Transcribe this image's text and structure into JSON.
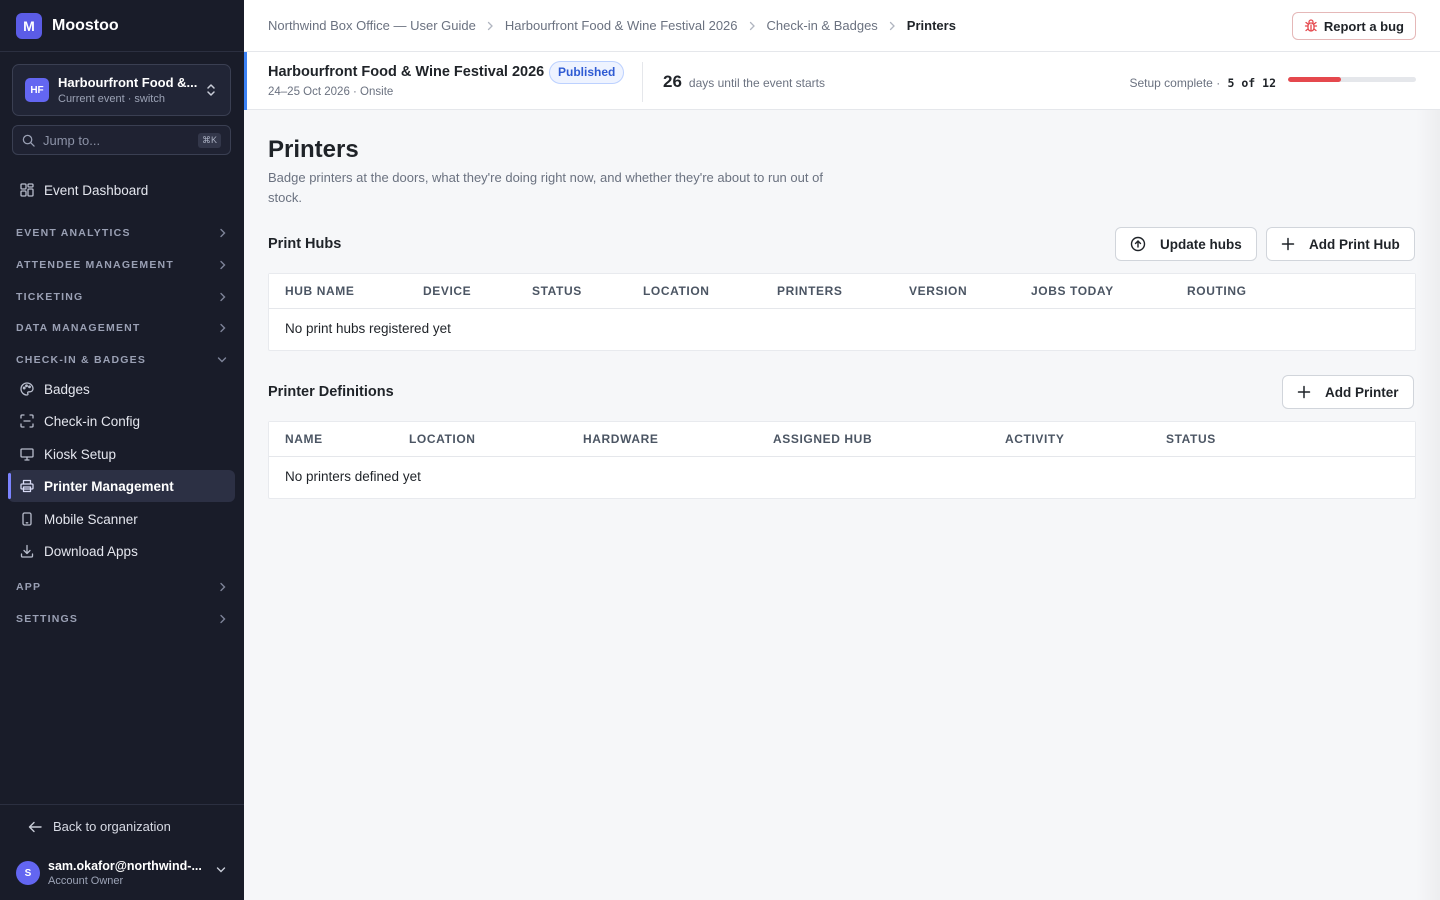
{
  "app": {
    "name": "Moostoo",
    "logo_letter": "M"
  },
  "event_switcher": {
    "initials": "HF",
    "name": "Harbourfront Food &...",
    "subtitle": "Current event · switch"
  },
  "search": {
    "placeholder": "Jump to...",
    "shortcut": "⌘K"
  },
  "sidebar": {
    "dashboard": {
      "label": "Event Dashboard",
      "icon": "grid-icon"
    },
    "sections": [
      {
        "label": "EVENT ANALYTICS",
        "expanded": false
      },
      {
        "label": "ATTENDEE MANAGEMENT",
        "expanded": false
      },
      {
        "label": "TICKETING",
        "expanded": false
      },
      {
        "label": "DATA MANAGEMENT",
        "expanded": false
      },
      {
        "label": "CHECK-IN & BADGES",
        "expanded": true
      },
      {
        "label": "APP",
        "expanded": false
      },
      {
        "label": "SETTINGS",
        "expanded": false
      }
    ],
    "checkin_items": [
      {
        "label": "Badges",
        "icon": "palette-icon",
        "active": false
      },
      {
        "label": "Check-in Config",
        "icon": "scan-icon",
        "active": false
      },
      {
        "label": "Kiosk Setup",
        "icon": "monitor-icon",
        "active": false
      },
      {
        "label": "Printer Management",
        "icon": "printer-icon",
        "active": true
      },
      {
        "label": "Mobile Scanner",
        "icon": "smartphone-icon",
        "active": false
      },
      {
        "label": "Download Apps",
        "icon": "download-icon",
        "active": false
      }
    ],
    "footer": {
      "back_label": "Back to organization",
      "user_initial": "S",
      "user_email": "sam.okafor@northwind-...",
      "user_role": "Account Owner"
    }
  },
  "breadcrumb": [
    "Northwind Box Office — User Guide",
    "Harbourfront Food & Wine Festival 2026",
    "Check-in & Badges",
    "Printers"
  ],
  "report_bug": {
    "label": "Report a bug",
    "icon": "bug-icon"
  },
  "event_header": {
    "title": "Harbourfront Food & Wine Festival 2026",
    "status": "Published",
    "dates": "24–25 Oct 2026 · Onsite",
    "days_count": "26",
    "days_label": "days until the event starts",
    "setup_label": "Setup complete ·",
    "setup_count": "5 of 12",
    "setup_done": 5,
    "setup_total": 12
  },
  "page": {
    "title": "Printers",
    "description": "Badge printers at the doors, what they're doing right now, and whether they're about to run out of stock."
  },
  "print_hubs": {
    "title": "Print Hubs",
    "update_button": "Update hubs",
    "add_button": "Add Print Hub",
    "columns": [
      "HUB NAME",
      "DEVICE",
      "STATUS",
      "LOCATION",
      "PRINTERS",
      "VERSION",
      "JOBS TODAY",
      "ROUTING"
    ],
    "empty_text": "No print hubs registered yet"
  },
  "printer_definitions": {
    "title": "Printer Definitions",
    "add_button": "Add Printer",
    "columns": [
      "NAME",
      "LOCATION",
      "HARDWARE",
      "ASSIGNED HUB",
      "ACTIVITY",
      "STATUS"
    ],
    "empty_text": "No printers defined yet"
  },
  "colors": {
    "sidebar_bg": "#191c29",
    "accent": "#5b5ce6",
    "progress": "#e5484d",
    "published_badge": "#2f5bd3"
  }
}
